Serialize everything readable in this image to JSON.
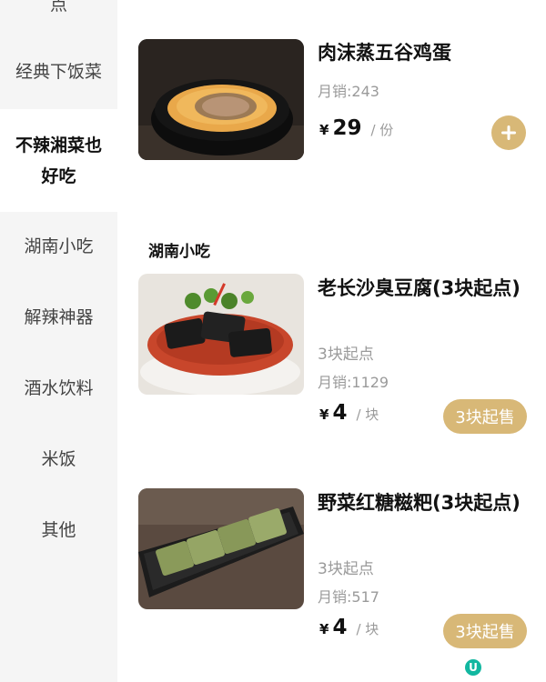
{
  "sidebar": {
    "items": [
      {
        "label": "点"
      },
      {
        "label": "经典下饭菜"
      },
      {
        "label": "不辣湘菜也好吃"
      },
      {
        "label": "湖南小吃"
      },
      {
        "label": "解辣神器"
      },
      {
        "label": "酒水饮料"
      },
      {
        "label": "米饭"
      },
      {
        "label": "其他"
      }
    ],
    "active_index": 2
  },
  "section": {
    "title": "湖南小吃"
  },
  "dishes": [
    {
      "name": "肉沫蒸五谷鸡蛋",
      "sales": "月销:243",
      "currency": "¥",
      "price": "29",
      "unit": "/ 份",
      "action": "+"
    },
    {
      "name": "老长沙臭豆腐(3块起点)",
      "sub": "3块起点",
      "sales": "月销:1129",
      "currency": "¥",
      "price": "4",
      "unit": "/ 块",
      "action": "3块起售"
    },
    {
      "name": "野菜红糖糍粑(3块起点)",
      "sub": "3块起点",
      "sales": "月销:517",
      "currency": "¥",
      "price": "4",
      "unit": "/ 块",
      "action": "3块起售"
    }
  ],
  "colors": {
    "accent": "#d8b877",
    "sidebar_bg": "#f5f5f5",
    "muted": "#9a9a9a"
  }
}
